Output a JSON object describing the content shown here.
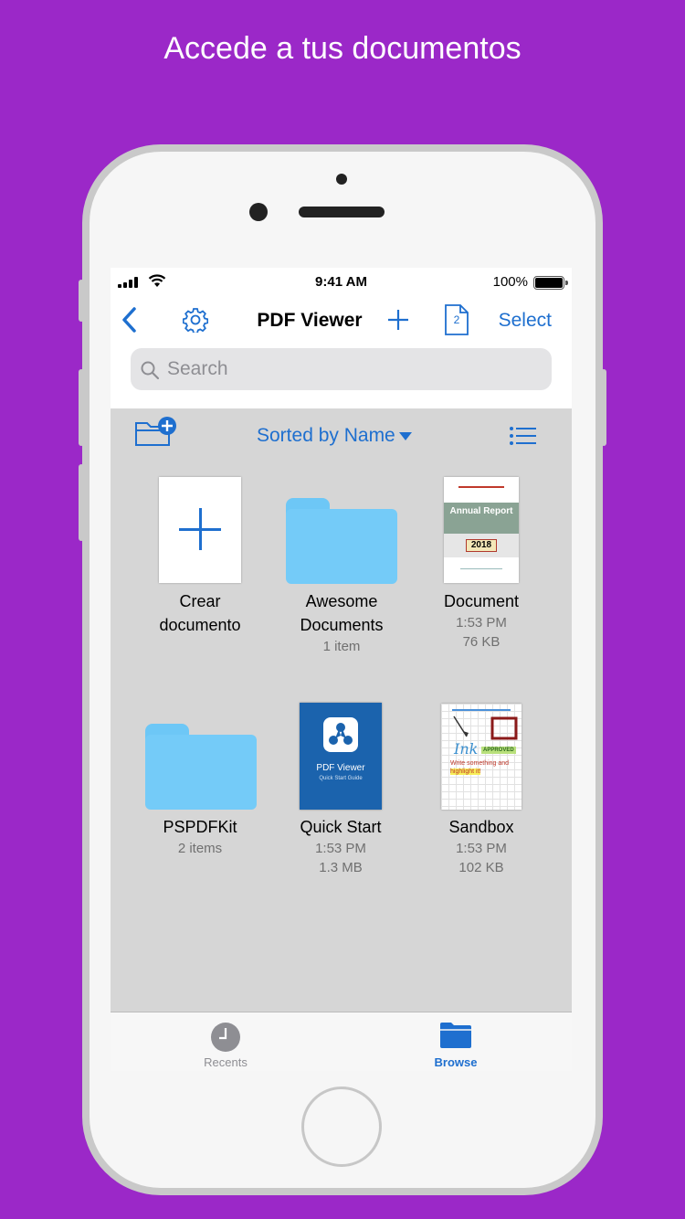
{
  "headline": "Accede a tus documentos",
  "statusbar": {
    "time": "9:41 AM",
    "battery": "100%"
  },
  "navbar": {
    "title": "PDF Viewer",
    "select_label": "Select",
    "doc_count": "2",
    "icons": [
      "back-chevron-icon",
      "gear-icon",
      "plus-icon",
      "document-count-icon"
    ]
  },
  "search": {
    "placeholder": "Search"
  },
  "toolbar": {
    "sort_label": "Sorted by Name",
    "icons": [
      "new-folder-icon",
      "list-view-icon",
      "caret-down-icon"
    ]
  },
  "items": [
    {
      "name": "Crear documento",
      "meta1": "",
      "meta2": ""
    },
    {
      "name": "Awesome Documents",
      "meta1": "1 item",
      "meta2": ""
    },
    {
      "name": "Document",
      "meta1": "1:53 PM",
      "meta2": "76 KB",
      "thumb_title": "Annual Report",
      "thumb_year": "2018"
    },
    {
      "name": "PSPDFKit",
      "meta1": "2 items",
      "meta2": ""
    },
    {
      "name": "Quick Start",
      "meta1": "1:53 PM",
      "meta2": "1.3 MB",
      "thumb_title": "PDF Viewer",
      "thumb_sub": "Quick Start Guide"
    },
    {
      "name": "Sandbox",
      "meta1": "1:53 PM",
      "meta2": "102 KB",
      "thumb_ink": "Ink",
      "thumb_approved": "APPROVED",
      "thumb_line1": "Write something and",
      "thumb_line2": "highlight it!"
    }
  ],
  "tabbar": {
    "recents": "Recents",
    "browse": "Browse",
    "active": "browse"
  },
  "colors": {
    "background": "#9b28c8",
    "accent": "#1e6fcf",
    "folder": "#74cbf8"
  }
}
